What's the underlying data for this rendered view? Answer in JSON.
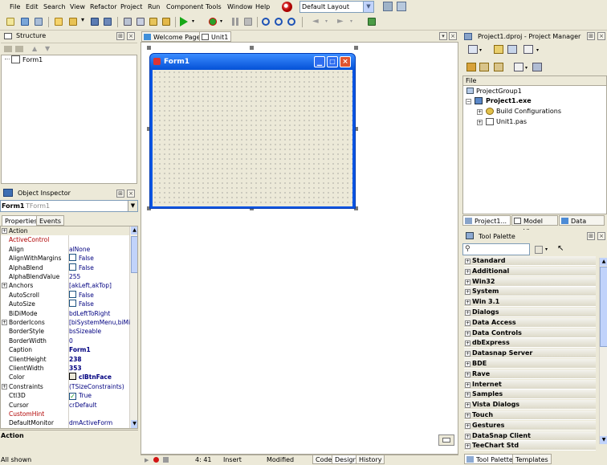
{
  "menu": [
    "File",
    "Edit",
    "Search",
    "View",
    "Refactor",
    "Project",
    "Run",
    "Component",
    "Tools",
    "Window",
    "Help"
  ],
  "layout_select": "Default Layout",
  "structure": {
    "title": "Structure",
    "items": [
      "Form1"
    ]
  },
  "tabs": [
    "Welcome Page",
    "Unit1"
  ],
  "form": {
    "caption": "Form1"
  },
  "object_inspector": {
    "title": "Object Inspector",
    "selector_name": "Form1",
    "selector_type": "TForm1",
    "tab_properties": "Properties",
    "tab_events": "Events",
    "rows": [
      {
        "name": "Action",
        "value": "",
        "style": "sel",
        "expand": true
      },
      {
        "name": "ActiveControl",
        "value": "",
        "style": "red"
      },
      {
        "name": "Align",
        "value": "alNone"
      },
      {
        "name": "AlignWithMargins",
        "value": "False",
        "check": false
      },
      {
        "name": "AlphaBlend",
        "value": "False",
        "check": false
      },
      {
        "name": "AlphaBlendValue",
        "value": "255"
      },
      {
        "name": "Anchors",
        "value": "[akLeft,akTop]",
        "expand": true
      },
      {
        "name": "AutoScroll",
        "value": "False",
        "check": false
      },
      {
        "name": "AutoSize",
        "value": "False",
        "check": false
      },
      {
        "name": "BiDiMode",
        "value": "bdLeftToRight"
      },
      {
        "name": "BorderIcons",
        "value": "[biSystemMenu,biMini",
        "expand": true
      },
      {
        "name": "BorderStyle",
        "value": "bsSizeable"
      },
      {
        "name": "BorderWidth",
        "value": "0"
      },
      {
        "name": "Caption",
        "value": "Form1",
        "bold": true
      },
      {
        "name": "ClientHeight",
        "value": "238",
        "bold": true
      },
      {
        "name": "ClientWidth",
        "value": "353",
        "bold": true
      },
      {
        "name": "Color",
        "value": "clBtnFace",
        "bold": true,
        "swatch": true
      },
      {
        "name": "Constraints",
        "value": "(TSizeConstraints)",
        "expand": true
      },
      {
        "name": "Ctl3D",
        "value": "True",
        "check": true
      },
      {
        "name": "Cursor",
        "value": "crDefault"
      },
      {
        "name": "CustomHint",
        "value": "",
        "style": "red"
      },
      {
        "name": "DefaultMonitor",
        "value": "dmActiveForm"
      }
    ],
    "footer": "Action",
    "status": "All shown"
  },
  "project_manager": {
    "title": "Project1.dproj - Project Manager",
    "column": "File",
    "tree": [
      "ProjectGroup1",
      "Project1.exe",
      "Build Configurations",
      "Unit1.pas"
    ],
    "tabs": [
      "Project1...",
      "Model View",
      "Data Ex..."
    ]
  },
  "tool_palette": {
    "title": "Tool Palette",
    "categories": [
      "Standard",
      "Additional",
      "Win32",
      "System",
      "Win 3.1",
      "Dialogs",
      "Data Access",
      "Data Controls",
      "dbExpress",
      "Datasnap Server",
      "BDE",
      "Rave",
      "Internet",
      "Samples",
      "Vista Dialogs",
      "Touch",
      "Gestures",
      "DataSnap Client",
      "TeeChart Std"
    ],
    "tabs": [
      "Tool Palette",
      "Templates"
    ]
  },
  "status": {
    "pos": "4: 41",
    "mode": "Insert",
    "state": "Modified",
    "tabs": [
      "Code",
      "Design",
      "History"
    ]
  }
}
